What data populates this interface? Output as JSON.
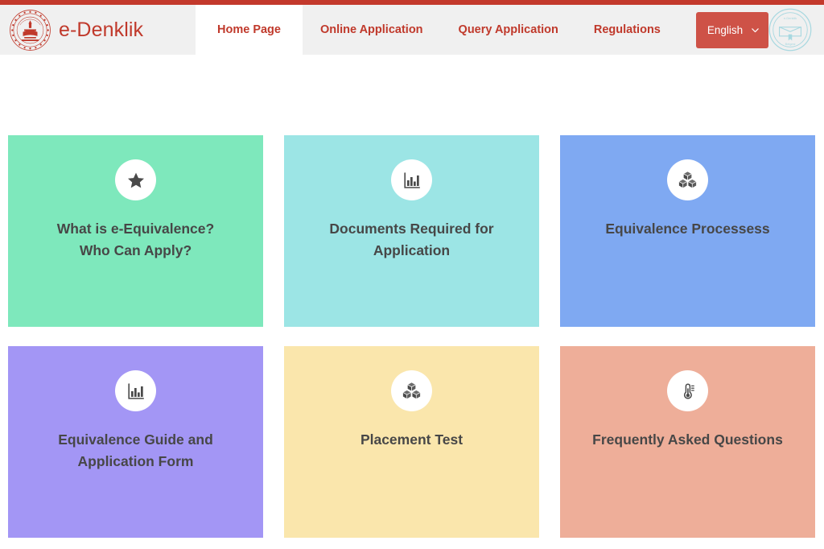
{
  "header": {
    "brand_name": "e-Denklik",
    "brand_emblem_icon": "ministry-emblem-icon",
    "seal_icon": "diploma-seal-icon",
    "nav_items": [
      {
        "label": "Home Page",
        "active": true
      },
      {
        "label": "Online Application",
        "active": false
      },
      {
        "label": "Query Application",
        "active": false
      },
      {
        "label": "Regulations",
        "active": false
      }
    ],
    "language_selector": {
      "value": "English",
      "chevron_icon": "chevron-down-icon"
    }
  },
  "colors": {
    "top_bar": "#c3392c",
    "header_bg": "#f0f0f0",
    "brand_red": "#c0392b",
    "lang_button": "#ce5247",
    "card_title": "#474747",
    "icon_dark": "#4a4a4a"
  },
  "cards": [
    {
      "title": "What is e-Equivalence?\nWho Can Apply?",
      "icon": "star-icon",
      "bg": "#7ee8bc"
    },
    {
      "title": "Documents Required for\nApplication",
      "icon": "bar-chart-icon",
      "bg": "#9ce5e5"
    },
    {
      "title": "Equivalence Processess",
      "icon": "cubes-icon",
      "bg": "#7fa9f2"
    },
    {
      "title": "Equivalence Guide and\nApplication Form",
      "icon": "bar-chart-icon",
      "bg": "#a396f5"
    },
    {
      "title": "Placement Test",
      "icon": "cubes-icon",
      "bg": "#fae6ac"
    },
    {
      "title": "Frequently Asked Questions",
      "icon": "thermometer-icon",
      "bg": "#eeae99"
    }
  ]
}
